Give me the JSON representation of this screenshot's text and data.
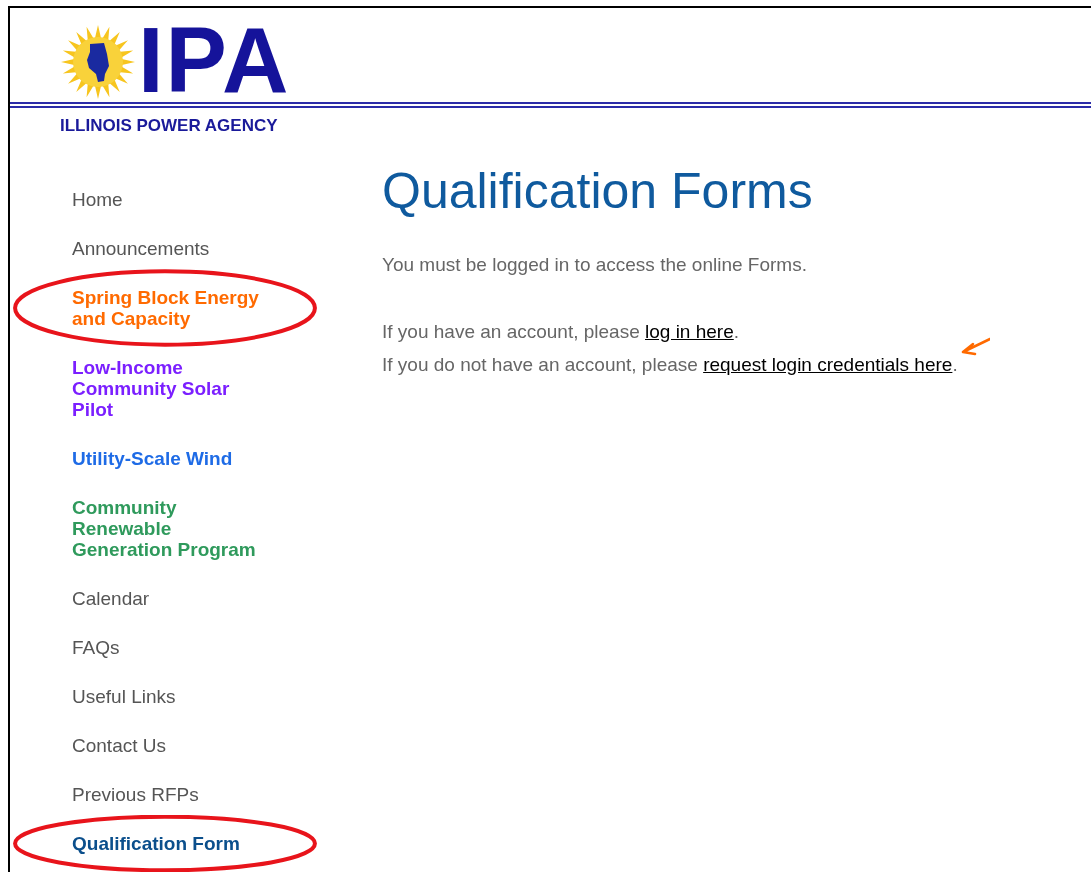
{
  "header": {
    "logo_text": "IPA",
    "agency_name": "ILLINOIS POWER AGENCY"
  },
  "nav": [
    {
      "label": "Home",
      "kind": "plain"
    },
    {
      "label": "Announcements",
      "kind": "plain"
    },
    {
      "label": "Spring Block Energy and Capacity",
      "kind": "program",
      "color": "#ff6a00",
      "circled": true
    },
    {
      "label": "Low-Income Community Solar Pilot",
      "kind": "program",
      "color": "#7b1fff"
    },
    {
      "label": "Utility-Scale Wind",
      "kind": "program",
      "color": "#1e6be6"
    },
    {
      "label": "Community Renewable Generation Program",
      "kind": "program",
      "color": "#2f9a5c"
    },
    {
      "label": "Calendar",
      "kind": "plain"
    },
    {
      "label": "FAQs",
      "kind": "plain"
    },
    {
      "label": "Useful Links",
      "kind": "plain"
    },
    {
      "label": "Contact Us",
      "kind": "plain"
    },
    {
      "label": "Previous RFPs",
      "kind": "plain"
    },
    {
      "label": "Qualification Form",
      "kind": "program",
      "color": "#0b4f8c",
      "circled": true
    }
  ],
  "main": {
    "title": "Qualification Forms",
    "notice": "You must be logged in to access the online Forms.",
    "lines": [
      {
        "before": "If you have an account, please ",
        "link": "log in here",
        "after": "."
      },
      {
        "before": "If you do not have an account, please ",
        "link": "request login credentials here",
        "after": ".",
        "arrow": true
      }
    ]
  }
}
